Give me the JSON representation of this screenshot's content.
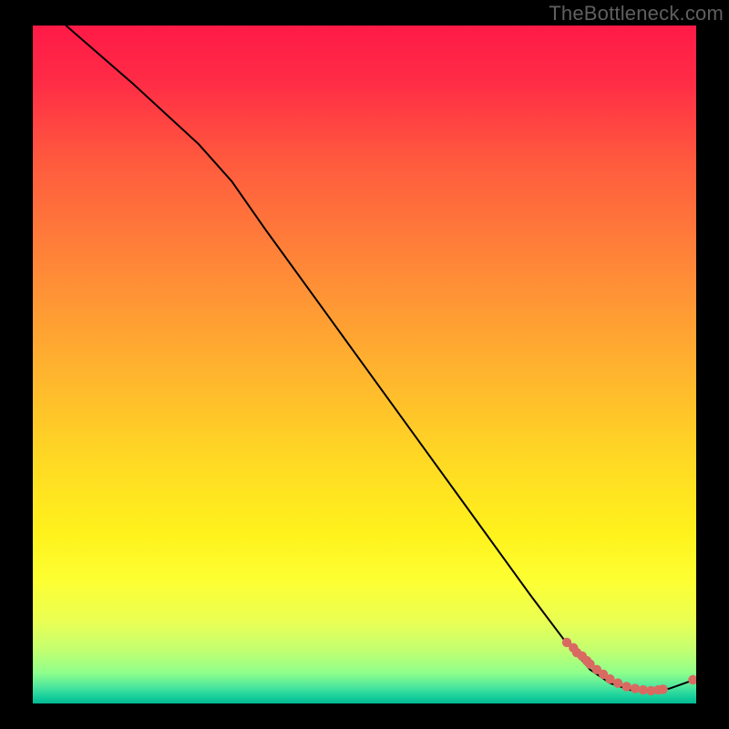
{
  "watermark": "TheBottleneck.com",
  "chart_data": {
    "type": "line",
    "title": "",
    "xlabel": "",
    "ylabel": "",
    "xlim": [
      0,
      100
    ],
    "ylim": [
      0,
      100
    ],
    "grid": false,
    "gradient_stops": [
      {
        "offset": 0.0,
        "color": "#ff1a47"
      },
      {
        "offset": 0.08,
        "color": "#ff2b46"
      },
      {
        "offset": 0.2,
        "color": "#ff5a3e"
      },
      {
        "offset": 0.35,
        "color": "#ff8638"
      },
      {
        "offset": 0.5,
        "color": "#ffb12f"
      },
      {
        "offset": 0.65,
        "color": "#ffdb23"
      },
      {
        "offset": 0.75,
        "color": "#fff21c"
      },
      {
        "offset": 0.82,
        "color": "#fdff33"
      },
      {
        "offset": 0.88,
        "color": "#e9ff54"
      },
      {
        "offset": 0.92,
        "color": "#c4ff70"
      },
      {
        "offset": 0.955,
        "color": "#8fff8b"
      },
      {
        "offset": 0.975,
        "color": "#4fe79d"
      },
      {
        "offset": 0.99,
        "color": "#17cf9c"
      },
      {
        "offset": 1.0,
        "color": "#04b893"
      }
    ],
    "series": [
      {
        "name": "curve",
        "type": "line",
        "color": "#000000",
        "x": [
          5.0,
          15.0,
          25.0,
          30.0,
          35.0,
          45.0,
          55.0,
          65.0,
          75.0,
          80.0,
          84.0,
          87.0,
          90.0,
          93.0,
          96.0,
          100.0
        ],
        "y": [
          100.0,
          91.5,
          82.5,
          77.0,
          70.0,
          56.5,
          43.0,
          29.5,
          16.0,
          9.5,
          5.0,
          3.0,
          2.0,
          1.8,
          2.2,
          3.6
        ]
      },
      {
        "name": "cluster-dots",
        "type": "scatter",
        "color": "#d96a62",
        "x": [
          80.5,
          81.5,
          82.0,
          82.8,
          83.5,
          84.0,
          85.0,
          86.0,
          87.0,
          88.2,
          89.5,
          90.8,
          92.0,
          93.2,
          94.3,
          95.0,
          99.5
        ],
        "y": [
          9.0,
          8.2,
          7.5,
          7.0,
          6.3,
          5.8,
          5.0,
          4.3,
          3.6,
          3.0,
          2.5,
          2.2,
          2.0,
          1.9,
          2.0,
          2.1,
          3.5
        ]
      }
    ]
  }
}
